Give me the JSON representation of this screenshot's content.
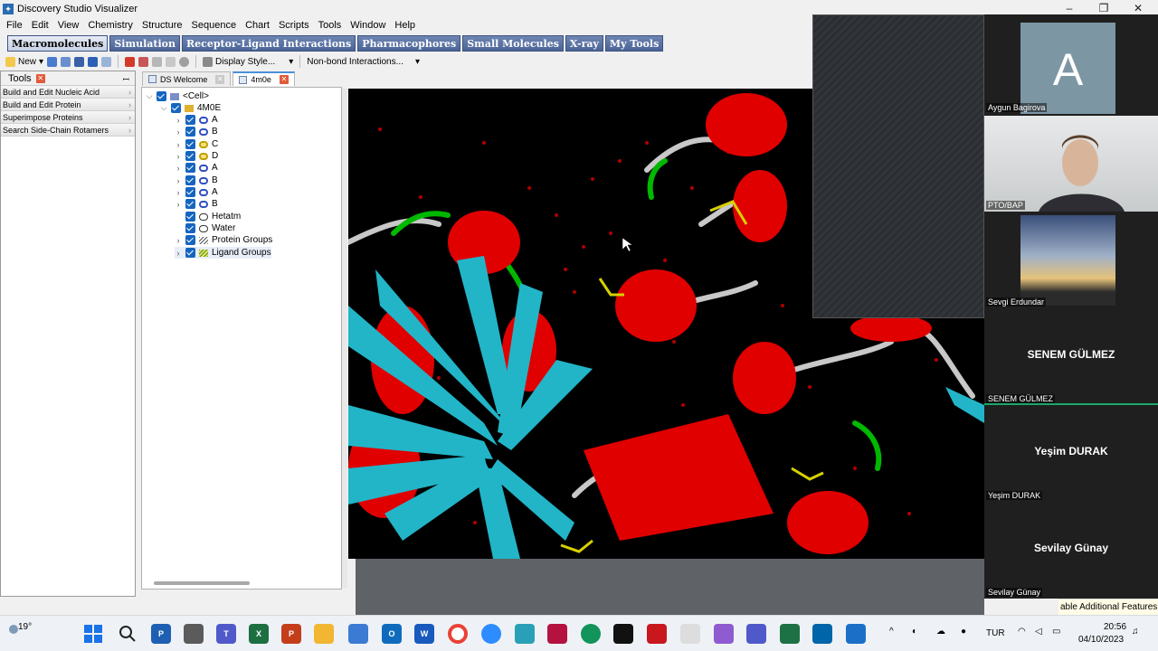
{
  "window": {
    "title": "Discovery Studio Visualizer",
    "controls": [
      "–",
      "❐",
      "✕"
    ]
  },
  "menu": [
    "File",
    "Edit",
    "View",
    "Chemistry",
    "Structure",
    "Sequence",
    "Chart",
    "Scripts",
    "Tools",
    "Window",
    "Help"
  ],
  "workspace_tabs": [
    "Macromolecules",
    "Simulation",
    "Receptor-Ligand Interactions",
    "Pharmacophores",
    "Small Molecules",
    "X-ray",
    "My Tools"
  ],
  "toolbar": {
    "new_label": "New",
    "display_style_label": "Display Style...",
    "nonbond_label": "Non-bond Interactions..."
  },
  "tools_panel": {
    "title": "Tools",
    "items": [
      "Build and Edit Nucleic Acid",
      "Build and Edit Protein",
      "Superimpose Proteins",
      "Search Side-Chain Rotamers"
    ]
  },
  "doc_tabs": [
    "DS Welcome",
    "4m0e"
  ],
  "tree": {
    "root": "<Cell>",
    "molecule": "4M0E",
    "chains": [
      "A",
      "B",
      "C",
      "D",
      "A",
      "B",
      "A",
      "B"
    ],
    "groups": [
      "Hetatm",
      "Water",
      "Protein Groups",
      "Ligand Groups"
    ]
  },
  "participants": [
    {
      "name": "Aygun Bagirova",
      "initial": "A"
    },
    {
      "name": "PTO/BAP"
    },
    {
      "name": "Sevgi Erdundar"
    },
    {
      "name": "SENEM GÜLMEZ",
      "display": "SENEM GÜLMEZ"
    },
    {
      "name": "Yeşim DURAK",
      "display": "Yeşim DURAK"
    },
    {
      "name": "Sevilay Günay",
      "display": "Sevilay Günay"
    }
  ],
  "tooltip": "able Additional Features",
  "taskbar": {
    "temperature": "19°",
    "language": "TUR",
    "time": "20:56",
    "date": "04/10/2023"
  },
  "colors": {
    "helix": "#e00000",
    "sheet": "#22b5c8",
    "turn": "#00b800",
    "coil": "#c8c8c8",
    "ligand": "#d6d000",
    "water": "#c00000"
  }
}
